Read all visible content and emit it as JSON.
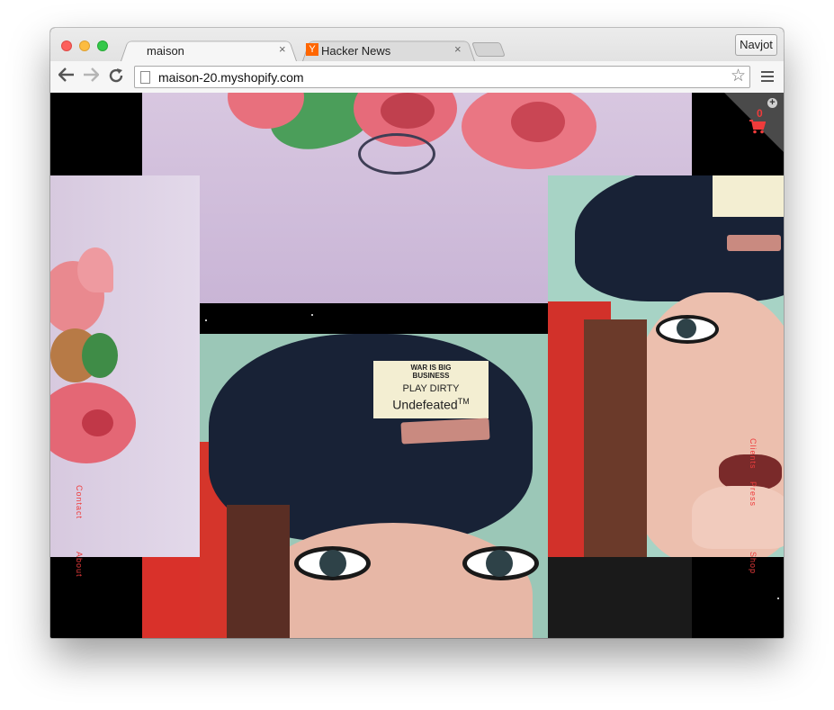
{
  "browser": {
    "tabs": [
      {
        "title": "maison",
        "active": true
      },
      {
        "title": "Hacker News",
        "favicon": "Y",
        "active": false
      }
    ],
    "profile_name": "Navjot",
    "url": "maison-20.myshopify.com",
    "close_glyph": "×"
  },
  "page": {
    "nav_left": [
      "Contact",
      "About"
    ],
    "nav_right": [
      "Press",
      "Clients",
      "Shop"
    ],
    "cart": {
      "count": "0"
    },
    "cap_label": {
      "line1": "WAR IS BIG",
      "line2": "BUSINESS",
      "line3": "PLAY DIRTY",
      "line4": "Undefeated",
      "tm": "TM"
    }
  },
  "colors": {
    "accent": "#ef3b3b",
    "rose": "#e86f79",
    "lavender": "#d3c3dc",
    "cap": "#182236"
  },
  "icons": [
    "back-arrow-icon",
    "forward-arrow-icon",
    "reload-icon",
    "page-icon",
    "star-icon",
    "hamburger-menu-icon",
    "cart-icon",
    "plus-icon"
  ]
}
